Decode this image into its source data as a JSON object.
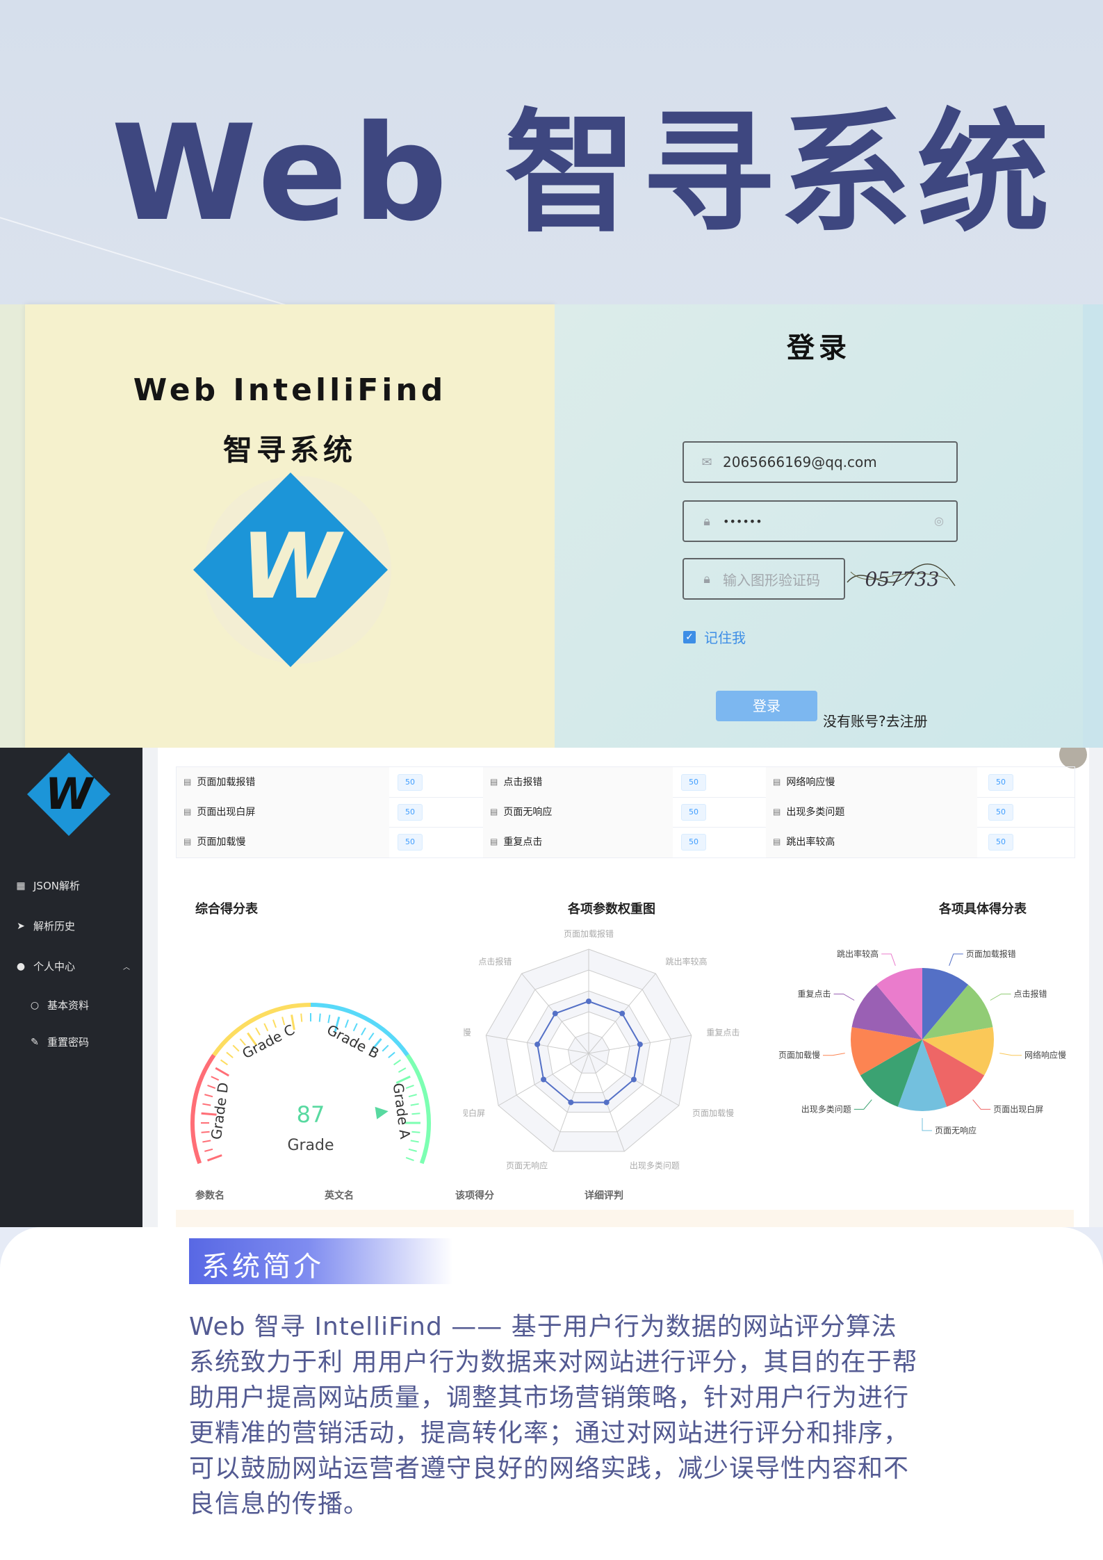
{
  "hero": {
    "title": "Web 智寻系统"
  },
  "login": {
    "brand_en": "Web IntelliFind",
    "brand_cn": "智寻系统",
    "logo_letter": "W",
    "title": "登录",
    "email_value": "2065666169@qq.com",
    "password_value": "••••••",
    "captcha_placeholder": "输入图形验证码",
    "captcha_text": "057733",
    "remember_label": "记住我",
    "submit_label": "登录",
    "register_link": "没有账号?去注册"
  },
  "dashboard": {
    "sidebar": {
      "logo_letter": "W",
      "items": [
        {
          "label": "JSON解析",
          "icon": "grid-icon"
        },
        {
          "label": "解析历史",
          "icon": "send-icon"
        },
        {
          "label": "个人中心",
          "icon": "user-icon"
        },
        {
          "label": "基本资料",
          "icon": "user-outline-icon"
        },
        {
          "label": "重置密码",
          "icon": "edit-icon"
        }
      ]
    },
    "metrics": [
      {
        "name": "页面加载报错",
        "score": "50"
      },
      {
        "name": "点击报错",
        "score": "50"
      },
      {
        "name": "网络响应慢",
        "score": "50"
      },
      {
        "name": "页面出现白屏",
        "score": "50"
      },
      {
        "name": "页面无响应",
        "score": "50"
      },
      {
        "name": "出现多类问题",
        "score": "50"
      },
      {
        "name": "页面加载慢",
        "score": "50"
      },
      {
        "name": "重复点击",
        "score": "50"
      },
      {
        "name": "跳出率较高",
        "score": "50"
      }
    ],
    "sections": {
      "gauge_title": "综合得分表",
      "radar_title": "各项参数权重图",
      "pie_title": "各项具体得分表"
    },
    "table_headers": [
      "参数名",
      "英文名",
      "该项得分",
      "详细评判"
    ],
    "colors": {
      "sidebar": "#23262c",
      "tag_blue": "#409eff"
    }
  },
  "gauge": {
    "value": "87",
    "unit": "Grade",
    "labels": [
      "Grade D",
      "Grade C",
      "Grade B",
      "Grade A"
    ]
  },
  "radar": {
    "indicators": [
      "页面加载报错",
      "跳出率较高",
      "重复点击",
      "页面加载慢",
      "出现多类问题",
      "页面无响应",
      "页面出现白屏",
      "网络响应慢",
      "点击报错"
    ],
    "values": [
      0.5,
      0.5,
      0.5,
      0.5,
      0.5,
      0.5,
      0.5,
      0.5,
      0.5
    ]
  },
  "chart_data": {
    "type": "pie",
    "title": "各项具体得分表",
    "slices": [
      {
        "label": "页面加载报错",
        "value": 50,
        "color": "#5470c6"
      },
      {
        "label": "点击报错",
        "value": 50,
        "color": "#91cc75"
      },
      {
        "label": "网络响应慢",
        "value": 50,
        "color": "#fac858"
      },
      {
        "label": "页面出现白屏",
        "value": 50,
        "color": "#ee6666"
      },
      {
        "label": "页面无响应",
        "value": 50,
        "color": "#73c0de"
      },
      {
        "label": "出现多类问题",
        "value": 50,
        "color": "#3ba272"
      },
      {
        "label": "页面加载慢",
        "value": 50,
        "color": "#fc8452"
      },
      {
        "label": "重复点击",
        "value": 50,
        "color": "#9a60b4"
      },
      {
        "label": "跳出率较高",
        "value": 50,
        "color": "#ea7ccc"
      }
    ]
  },
  "intro": {
    "heading": "系统简介",
    "body": "Web 智寻 IntelliFind —— 基于用户行为数据的网站评分算法系统致力于利 用用户行为数据来对网站进行评分，其目的在于帮助用户提高网站质量，调整其市场营销策略，针对用户行为进行更精准的营销活动，提高转化率；通过对网站进行评分和排序，可以鼓励网站运营者遵守良好的网络实践，减少误导性内容和不良信息的传播。"
  }
}
